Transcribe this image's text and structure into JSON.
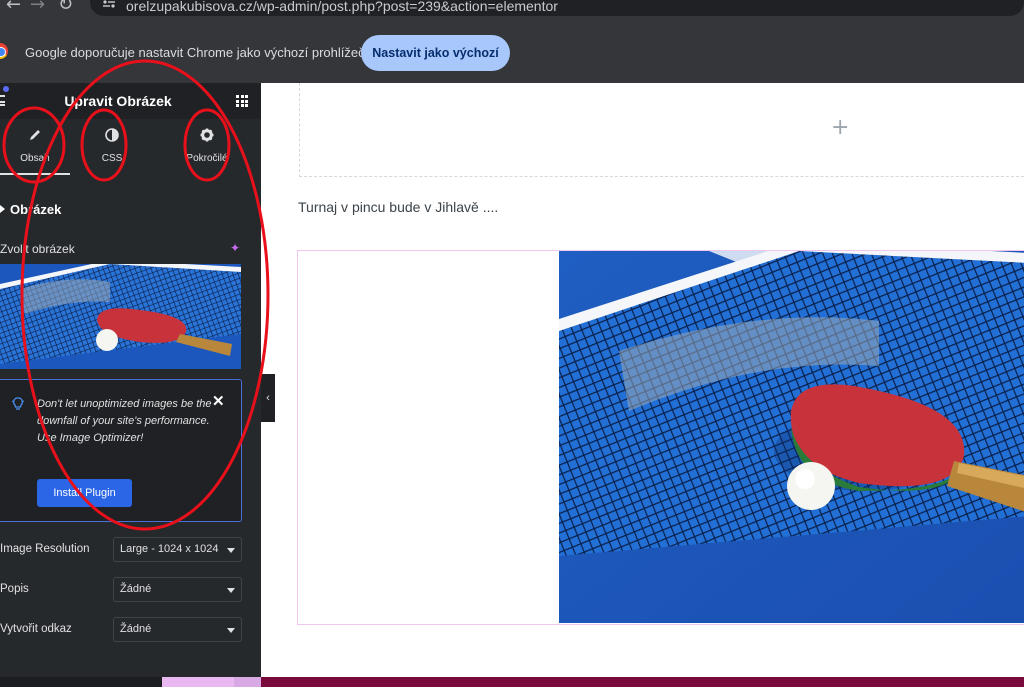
{
  "browser": {
    "url": "orelzupakubisova.cz/wp-admin/post.php?post=239&action=elementor",
    "infobar_text": "Google doporučuje nastavit Chrome jako výchozí prohlížeč",
    "infobar_button": "Nastavit jako výchozí"
  },
  "panel": {
    "title": "Upravit Obrázek",
    "tabs": [
      {
        "label": "Obsah",
        "icon": "pencil-icon",
        "active": true
      },
      {
        "label": "CSS",
        "icon": "contrast-icon",
        "active": false
      },
      {
        "label": "Pokročilé",
        "icon": "gear-icon",
        "active": false
      }
    ],
    "section_title": "Obrázek",
    "choose_image_label": "Zvolit obrázek",
    "notice": {
      "text": "Don't let unoptimized images be the downfall of your site's performance. Use Image Optimizer!",
      "button": "Install Plugin"
    },
    "controls": [
      {
        "label": "Image Resolution",
        "value": "Large - 1024 x 1024"
      },
      {
        "label": "Popis",
        "value": "Žádné"
      },
      {
        "label": "Vytvořit odkaz",
        "value": "Žádné"
      }
    ]
  },
  "canvas": {
    "text": "Turnaj v pincu bude v Jihlavě ...."
  },
  "colors": {
    "panel_bg": "#26292c",
    "accent_blue": "#2a66e6",
    "widget_border": "#f0c6ee",
    "annotation_red": "#e8101a"
  }
}
